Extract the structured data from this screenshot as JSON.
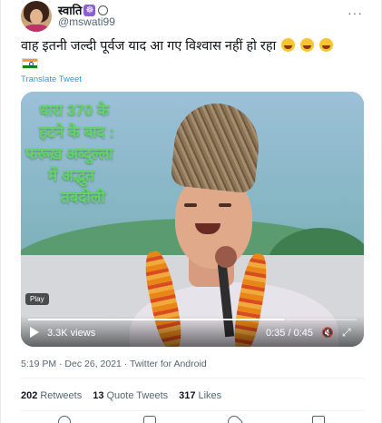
{
  "author": {
    "display_name": "स्वाति",
    "emoji_badge": "☸",
    "handle": "@mswati99"
  },
  "header": {
    "more_label": "···"
  },
  "tweet": {
    "text": "वाह इतनी जल्दी पूर्वज याद आ गए विश्वास नहीं हो रहा",
    "emoji_count": 3,
    "flag": "india-flag",
    "translate_label": "Translate Tweet"
  },
  "video": {
    "overlay_lines": [
      "धारा 370 के",
      "हटने के बाद :",
      "फरूख़ अब्दुल्ला",
      "में अद्भुत",
      "तबदीली"
    ],
    "play_badge": "Play",
    "views": "3.3K views",
    "time": "0:35 / 0:45",
    "mute_icon": "🔇",
    "fullscreen_icon": "⤢",
    "progress": 0.78,
    "overlay_color": "#5fd75f"
  },
  "meta": {
    "timestamp": "5:19 PM · Dec 26, 2021 · Twitter for Android"
  },
  "stats": {
    "retweets_count": "202",
    "retweets_label": "Retweets",
    "quotes_count": "13",
    "quotes_label": "Quote Tweets",
    "likes_count": "317",
    "likes_label": "Likes"
  },
  "colors": {
    "link": "#1d9bf0",
    "secondary_text": "#536471"
  }
}
